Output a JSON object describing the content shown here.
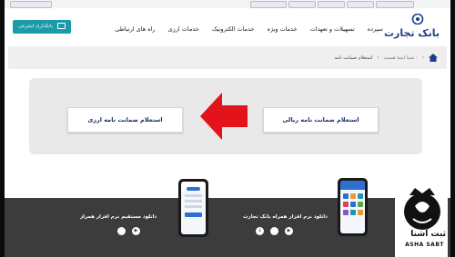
{
  "top_strip": {
    "items": [
      "",
      "",
      "",
      "",
      "",
      ""
    ]
  },
  "header": {
    "logo_text": "بانک تجارت",
    "menu": [
      "سپرده",
      "تسهیلات و تعهدات",
      "خدمات ویژه",
      "خدمات الکترونیک",
      "خدمات ارزی",
      "راه های ارتباطی"
    ],
    "ebank_button": "بانکداری اینترنتی"
  },
  "breadcrumb": {
    "prefix": "شما اینجا هستید :",
    "current": "استعلام ضمانت نامه"
  },
  "main": {
    "option_riyal": "استعلام ضمانت نامه ریالی",
    "option_arzi": "استعلام ضمانت نامه ارزی"
  },
  "footer": {
    "app_title_1": "دانلود نرم افزار همراه بانک تجارت",
    "app_title_2": "دانلود مستقیم نرم افزار همراز",
    "store_icons": [
      "android-icon",
      "apple-icon",
      "direct-download-icon"
    ]
  },
  "watermark": {
    "fa": "ثبت آشنا",
    "en": "ASHA SABT"
  },
  "colors": {
    "brand_blue": "#1c3d8c",
    "teal": "#1b9aa9",
    "arrow_red": "#e3131b",
    "footer_bg": "#3c3c3c"
  }
}
